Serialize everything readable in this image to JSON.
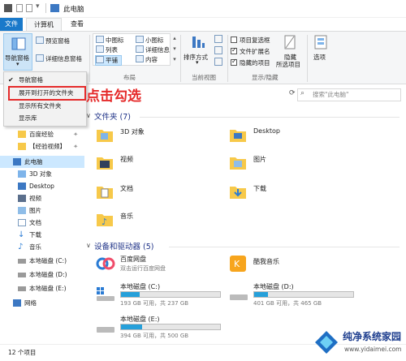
{
  "window": {
    "title": "此电脑"
  },
  "tabs": {
    "file": "文件",
    "computer": "计算机",
    "view": "查看"
  },
  "ribbon": {
    "nav_pane": "导航窗格",
    "preview_pane": "预览窗格",
    "details_pane": "详细信息窗格",
    "layout": {
      "medium_icons": "中图标",
      "small_icons": "小图标",
      "list": "列表",
      "details": "详细信息",
      "tiles": "平铺",
      "content": "内容",
      "group_label": "布局"
    },
    "sort_by": "排序方式",
    "current_view": "当前视图",
    "item_checkboxes": "项目复选框",
    "file_extensions": "文件扩展名",
    "hidden_items": "隐藏的项目",
    "hide_selected_line1": "隐藏",
    "hide_selected_line2": "所选项目",
    "show_hide": "显示/隐藏",
    "options": "选项"
  },
  "dropdown": {
    "items": [
      "导航窗格",
      "展开到打开的文件夹",
      "显示所有文件夹",
      "显示库"
    ]
  },
  "annotation": "点击勾选",
  "search": {
    "placeholder": "搜索\"此电脑\""
  },
  "sidebar": {
    "items": [
      "百度经验",
      "【经验视频】",
      "此电脑",
      "3D 对象",
      "Desktop",
      "视频",
      "图片",
      "文档",
      "下载",
      "音乐",
      "本地磁盘 (C:)",
      "本地磁盘 (D:)",
      "本地磁盘 (E:)",
      "网络"
    ]
  },
  "main": {
    "folders_header": "文件夹 (7)",
    "folders": [
      "3D 对象",
      "Desktop",
      "视频",
      "图片",
      "文档",
      "下载",
      "音乐"
    ],
    "devices_header": "设备和驱动器 (5)",
    "apps": [
      {
        "name": "百度网盘",
        "sub": "双击运行百度网盘"
      },
      {
        "name": "酷我音乐",
        "sub": ""
      }
    ],
    "drives": [
      {
        "name": "本地磁盘 (C:)",
        "free": "193 GB 可用，共 237 GB",
        "used": 0.19
      },
      {
        "name": "本地磁盘 (D:)",
        "free": "401 GB 可用，共 465 GB",
        "used": 0.14
      },
      {
        "name": "本地磁盘 (E:)",
        "free": "394 GB 可用，共 500 GB",
        "used": 0.21
      }
    ]
  },
  "status": {
    "count": "12 个项目"
  },
  "watermark": {
    "cn": "纯净系统家园",
    "url": "www.yidaimei.com"
  },
  "colors": {
    "accent": "#1979ca",
    "folder": "#f7c94a",
    "annotation": "#e52b2b",
    "drive_fill": "#26a0da"
  }
}
